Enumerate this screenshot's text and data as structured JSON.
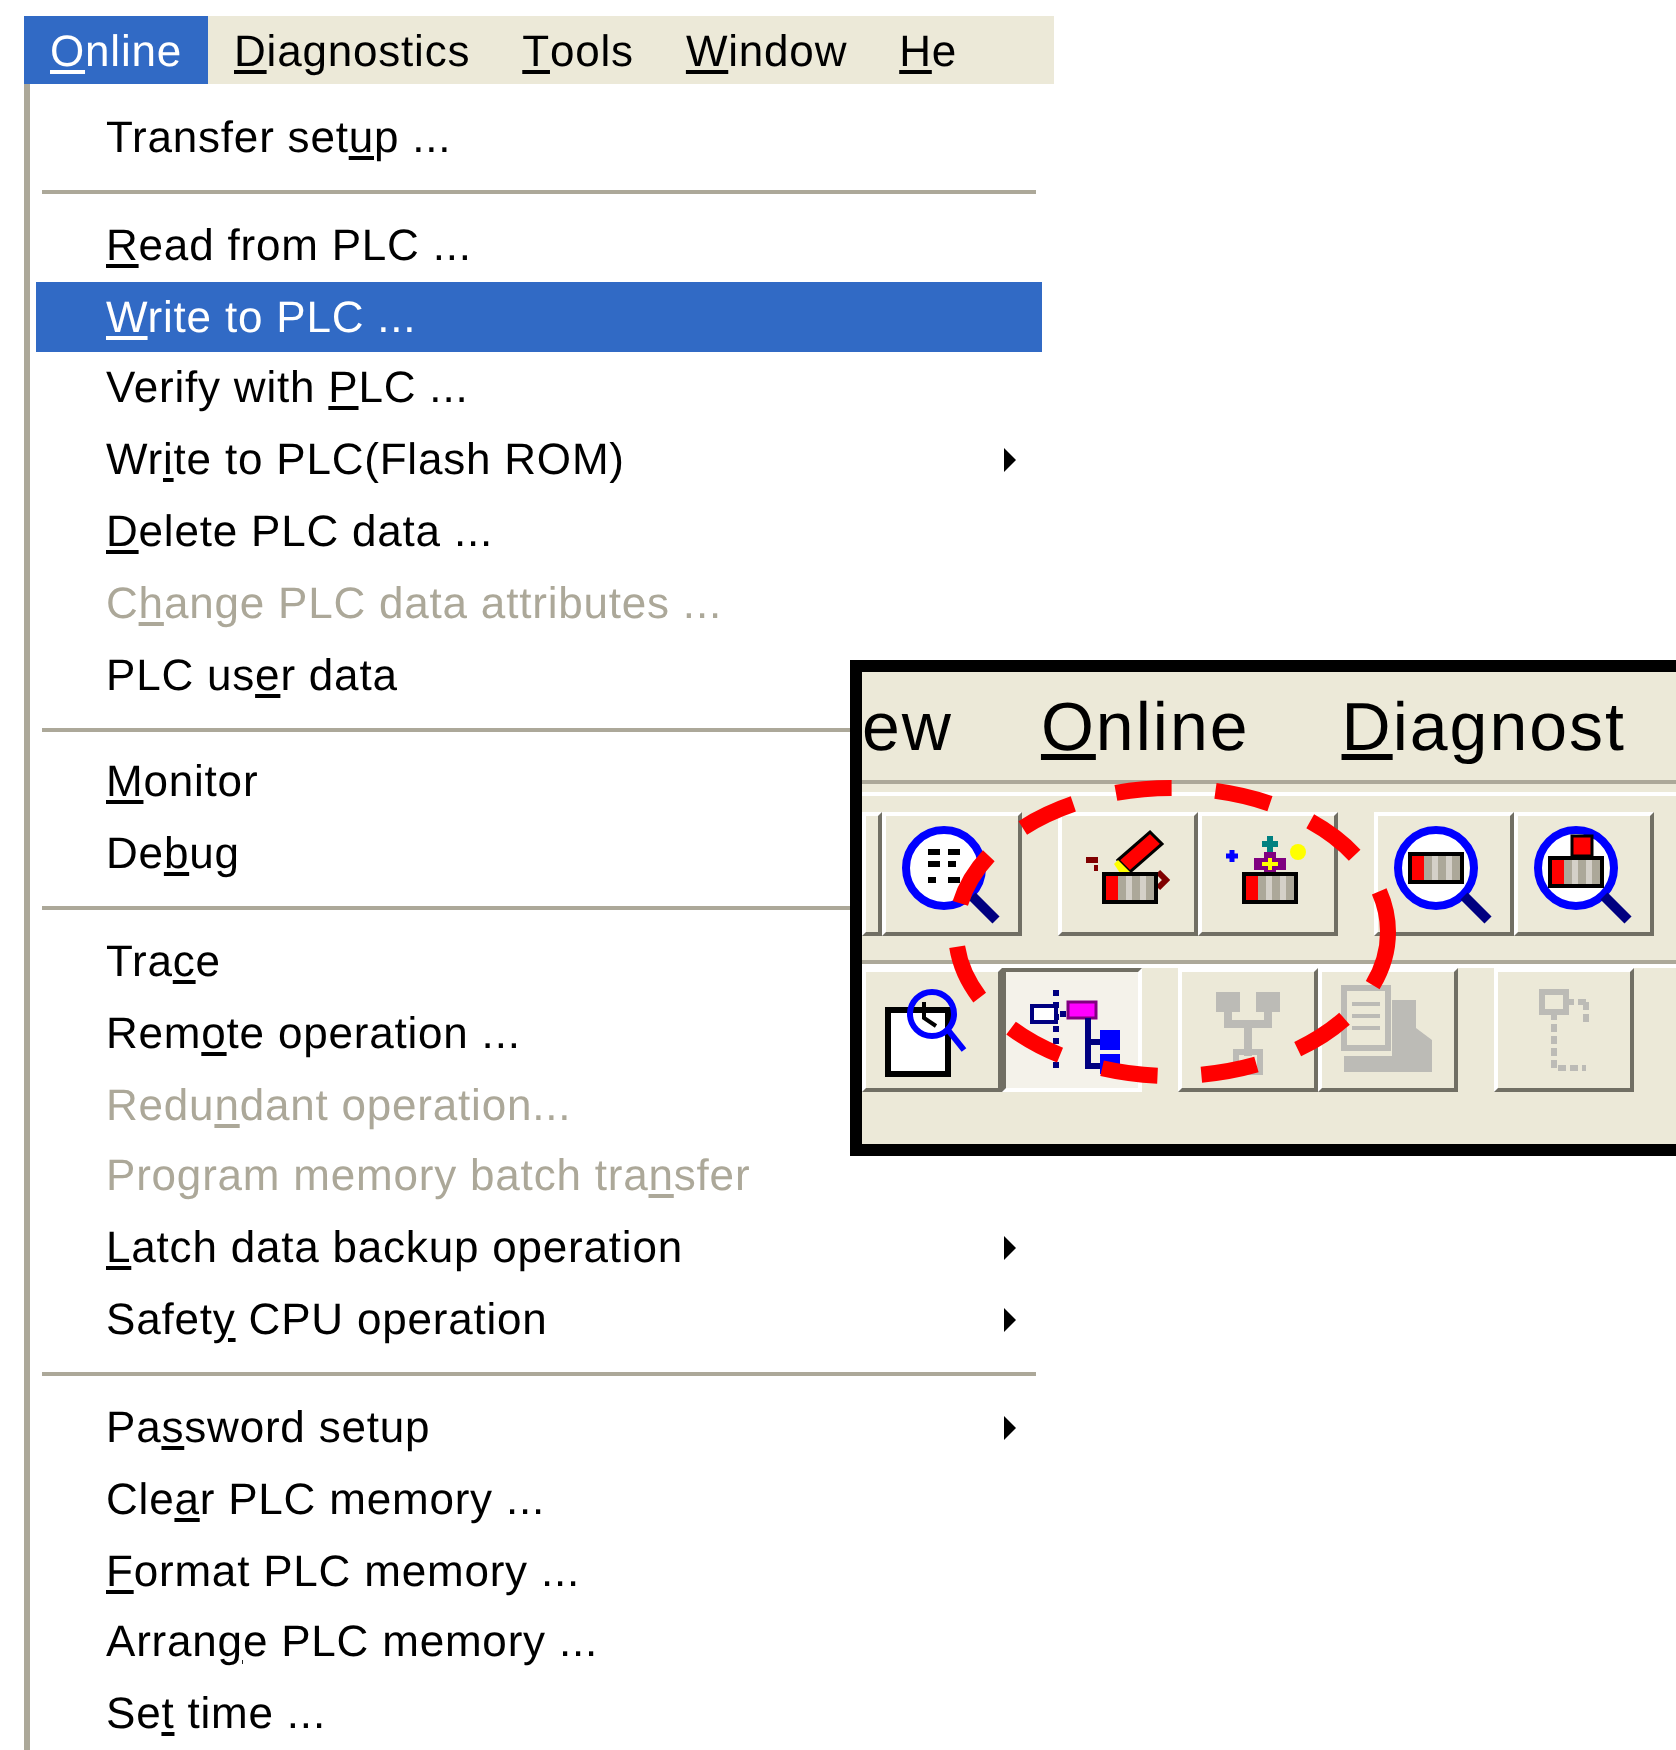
{
  "menu_bar": [
    {
      "key": "O",
      "post": "nline",
      "selected": true
    },
    {
      "key": "D",
      "post": "iagnostics",
      "selected": false
    },
    {
      "key": "T",
      "post": "ools",
      "selected": false
    },
    {
      "key": "W",
      "post": "indow",
      "selected": false
    },
    {
      "key": "H",
      "post": "e",
      "selected": false
    }
  ],
  "online_menu": {
    "groups": [
      {
        "items": [
          {
            "pre": "Transfer set",
            "key": "u",
            "post": "p ...",
            "selected": false,
            "disabled": false,
            "submenu": false
          }
        ]
      },
      {
        "items": [
          {
            "key": "R",
            "post": "ead from PLC ...",
            "selected": false,
            "disabled": false,
            "submenu": false
          },
          {
            "key": "W",
            "post": "rite to PLC ...",
            "selected": true,
            "disabled": false,
            "submenu": false
          },
          {
            "pre": "Verify with ",
            "key": "P",
            "post": "LC ...",
            "selected": false,
            "disabled": false,
            "submenu": false
          },
          {
            "pre": "Wr",
            "key": "i",
            "post": "te to PLC(Flash ROM)",
            "selected": false,
            "disabled": false,
            "submenu": true
          },
          {
            "key": "D",
            "post": "elete PLC data ...",
            "selected": false,
            "disabled": false,
            "submenu": false
          },
          {
            "pre": "C",
            "key": "h",
            "post": "ange PLC data attributes ...",
            "selected": false,
            "disabled": true,
            "submenu": false
          },
          {
            "pre": "PLC us",
            "key": "e",
            "post": "r data",
            "selected": false,
            "disabled": false,
            "submenu": false
          }
        ]
      },
      {
        "items": [
          {
            "key": "M",
            "post": "onitor",
            "selected": false,
            "disabled": false,
            "submenu": false
          },
          {
            "pre": "De",
            "key": "b",
            "post": "ug",
            "selected": false,
            "disabled": false,
            "submenu": false
          }
        ]
      },
      {
        "items": [
          {
            "pre": "Tra",
            "key": "c",
            "post": "e",
            "selected": false,
            "disabled": false,
            "submenu": false
          },
          {
            "pre": "Rem",
            "key": "o",
            "post": "te operation ...",
            "selected": false,
            "disabled": false,
            "submenu": false
          },
          {
            "pre": "Redu",
            "key": "n",
            "post": "dant operation...",
            "selected": false,
            "disabled": true,
            "submenu": false
          },
          {
            "pre": "Program memory batch tra",
            "key": "n",
            "post": "sfer",
            "selected": false,
            "disabled": true,
            "submenu": false
          },
          {
            "key": "L",
            "post": "atch data backup operation",
            "selected": false,
            "disabled": false,
            "submenu": true
          },
          {
            "pre": "Safet",
            "key": "y",
            "post": " CPU operation",
            "selected": false,
            "disabled": false,
            "submenu": true
          }
        ]
      },
      {
        "items": [
          {
            "pre": "Pa",
            "key": "s",
            "post": "sword setup",
            "selected": false,
            "disabled": false,
            "submenu": true
          },
          {
            "pre": "Cle",
            "key": "a",
            "post": "r PLC memory ...",
            "selected": false,
            "disabled": false,
            "submenu": false
          },
          {
            "key": "F",
            "post": "ormat PLC memory ...",
            "selected": false,
            "disabled": false,
            "submenu": false
          },
          {
            "pre": "Arran",
            "key": "g",
            "post": "e PLC memory ...",
            "selected": false,
            "disabled": false,
            "submenu": false
          },
          {
            "pre": "Se",
            "key": "t",
            "post": " time ...",
            "selected": false,
            "disabled": false,
            "submenu": false
          }
        ]
      }
    ]
  },
  "inset": {
    "menu_bar": [
      {
        "pre": "ew"
      },
      {
        "key": "O",
        "post": "nline"
      },
      {
        "key": "D",
        "post": "iagnost"
      }
    ],
    "toolbar_1": [
      {
        "kind": "edge"
      },
      {
        "kind": "all-monitor"
      },
      {
        "kind": "gap"
      },
      {
        "kind": "write"
      },
      {
        "kind": "read"
      },
      {
        "kind": "gap"
      },
      {
        "kind": "monitor"
      },
      {
        "kind": "monitor-write"
      }
    ],
    "toolbar_2": [
      {
        "kind": "doc-search",
        "pressed": false,
        "disabled": false
      },
      {
        "kind": "tree",
        "pressed": true,
        "disabled": false
      },
      {
        "kind": "gap"
      },
      {
        "kind": "network",
        "pressed": false,
        "disabled": true
      },
      {
        "kind": "list",
        "pressed": false,
        "disabled": true
      },
      {
        "kind": "gap"
      },
      {
        "kind": "ladder",
        "pressed": false,
        "disabled": true
      }
    ]
  }
}
